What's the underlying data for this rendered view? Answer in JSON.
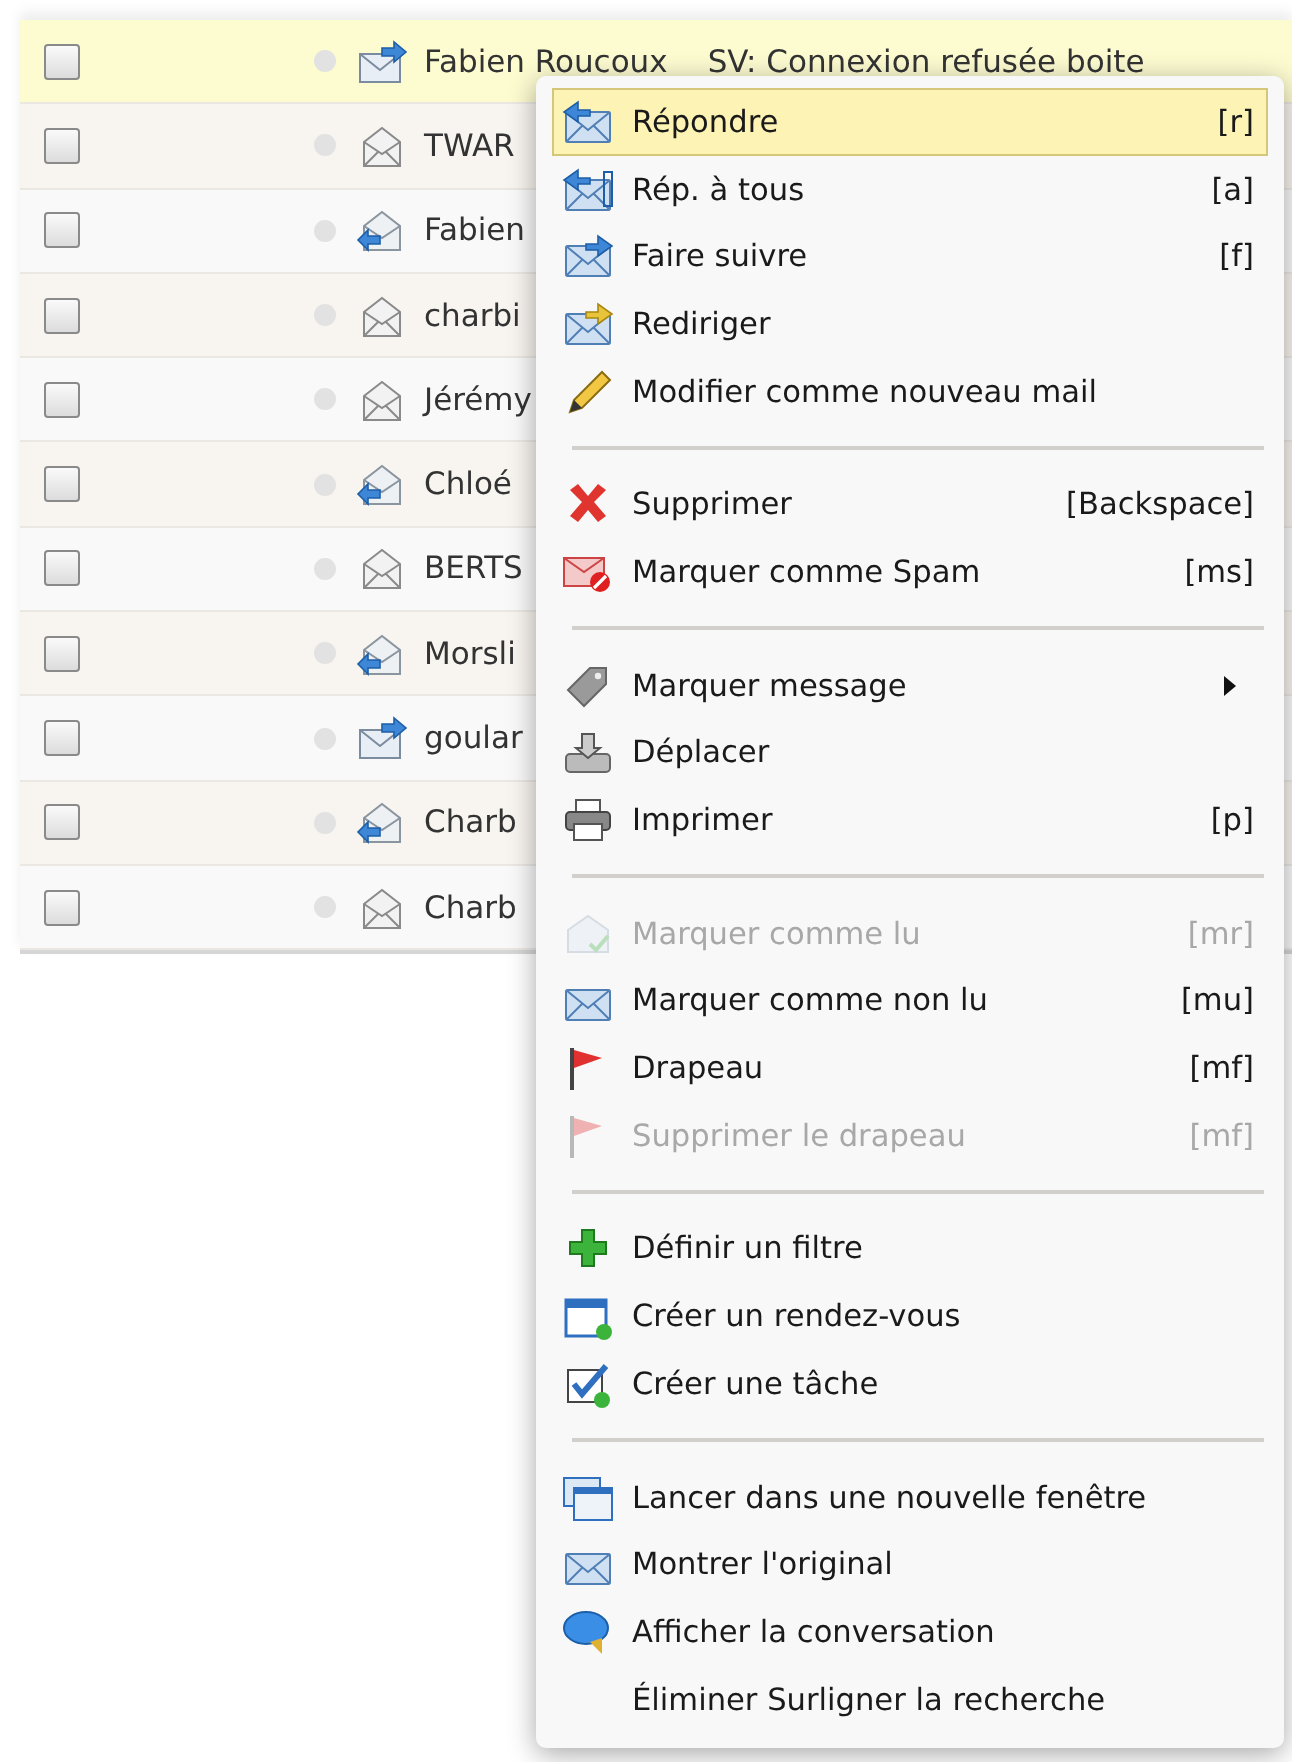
{
  "messages": [
    {
      "sender": "Fabien Roucoux",
      "subject": "SV: Connexion refusée boite",
      "kind": "forwarded",
      "selected": true
    },
    {
      "sender": "TWAR",
      "kind": "plain",
      "selected": false
    },
    {
      "sender": "Fabien",
      "kind": "replied",
      "selected": false
    },
    {
      "sender": "charbi",
      "kind": "plain",
      "selected": false
    },
    {
      "sender": "Jérémy",
      "kind": "plain",
      "selected": false
    },
    {
      "sender": "Chloé",
      "kind": "replied",
      "selected": false
    },
    {
      "sender": "BERTS",
      "kind": "plain",
      "selected": false
    },
    {
      "sender": "Morsli",
      "kind": "replied",
      "selected": false
    },
    {
      "sender": "goular",
      "kind": "forwarded",
      "selected": false
    },
    {
      "sender": "Charb",
      "kind": "replied",
      "selected": false
    },
    {
      "sender": "Charb",
      "kind": "plain",
      "selected": false
    }
  ],
  "context_menu": {
    "items": [
      {
        "kind": "item",
        "label": "Répondre",
        "shortcut": "[r]",
        "selected": true,
        "disabled": false
      },
      {
        "kind": "item",
        "label": "Rép. à tous",
        "shortcut": "[a]",
        "selected": false,
        "disabled": false
      },
      {
        "kind": "item",
        "label": "Faire suivre",
        "shortcut": "[f]",
        "selected": false,
        "disabled": false
      },
      {
        "kind": "item",
        "label": "Rediriger",
        "selected": false,
        "disabled": false
      },
      {
        "kind": "item",
        "label": "Modifier comme nouveau mail",
        "selected": false,
        "disabled": false
      },
      {
        "kind": "separator"
      },
      {
        "kind": "item",
        "label": "Supprimer",
        "shortcut": "[Backspace]",
        "selected": false,
        "disabled": false
      },
      {
        "kind": "item",
        "label": "Marquer comme Spam",
        "shortcut": "[ms]",
        "selected": false,
        "disabled": false
      },
      {
        "kind": "separator"
      },
      {
        "kind": "item",
        "label": "Marquer message",
        "submenu": true,
        "selected": false,
        "disabled": false
      },
      {
        "kind": "item",
        "label": "Déplacer",
        "selected": false,
        "disabled": false
      },
      {
        "kind": "item",
        "label": "Imprimer",
        "shortcut": "[p]",
        "selected": false,
        "disabled": false
      },
      {
        "kind": "separator"
      },
      {
        "kind": "item",
        "label": "Marquer comme lu",
        "shortcut": "[mr]",
        "selected": false,
        "disabled": true
      },
      {
        "kind": "item",
        "label": "Marquer comme non lu",
        "shortcut": "[mu]",
        "selected": false,
        "disabled": false
      },
      {
        "kind": "item",
        "label": "Drapeau",
        "shortcut": "[mf]",
        "selected": false,
        "disabled": false
      },
      {
        "kind": "item",
        "label": "Supprimer le drapeau",
        "shortcut": "[mf]",
        "selected": false,
        "disabled": true
      },
      {
        "kind": "separator"
      },
      {
        "kind": "item",
        "label": "Définir un filtre",
        "selected": false,
        "disabled": false
      },
      {
        "kind": "item",
        "label": "Créer un rendez-vous",
        "selected": false,
        "disabled": false
      },
      {
        "kind": "item",
        "label": "Créer une tâche",
        "selected": false,
        "disabled": false
      },
      {
        "kind": "separator"
      },
      {
        "kind": "item",
        "label": "Lancer dans une nouvelle fenêtre",
        "selected": false,
        "disabled": false
      },
      {
        "kind": "item",
        "label": "Montrer l'original",
        "selected": false,
        "disabled": false
      },
      {
        "kind": "item",
        "label": "Afficher la conversation",
        "selected": false,
        "disabled": false
      },
      {
        "kind": "item",
        "label": "Éliminer Surligner la recherche",
        "selected": false,
        "disabled": false
      }
    ]
  }
}
